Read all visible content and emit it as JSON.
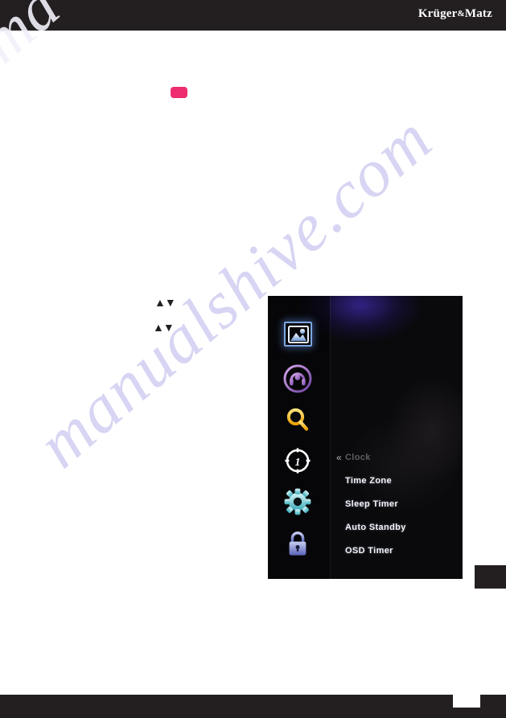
{
  "header": {
    "brand_name": "Krüger",
    "brand_amp": "&",
    "brand_name2": "Matz"
  },
  "watermark": {
    "text": "manualshive.com",
    "corner_text": "ma",
    "color": "#c9c6ef"
  },
  "badge": {
    "color": "#ed2d70",
    "label": ""
  },
  "arrow_hints": [
    {
      "glyph": "▲▼",
      "name": "up-down-arrows"
    },
    {
      "glyph": "▲▼",
      "name": "up-down-arrows"
    }
  ],
  "osd": {
    "icons": [
      {
        "name": "picture-icon",
        "label": "Picture",
        "selected": true,
        "color": "#cfe2f7"
      },
      {
        "name": "headphones-icon",
        "label": "Sound",
        "selected": false,
        "color": "#b07fd4"
      },
      {
        "name": "search-icon",
        "label": "Channel",
        "selected": false,
        "color": "#f5c024"
      },
      {
        "name": "clock-icon",
        "label": "Time",
        "selected": false,
        "color": "#ffffff"
      },
      {
        "name": "gear-icon",
        "label": "Setup",
        "selected": false,
        "color": "#7fd8d8"
      },
      {
        "name": "lock-icon",
        "label": "Lock",
        "selected": false,
        "color": "#7d85d0"
      }
    ],
    "menu_items": [
      {
        "label": "Clock",
        "dimmed": true,
        "chevron": "«"
      },
      {
        "label": "Time Zone",
        "dimmed": false,
        "chevron": ""
      },
      {
        "label": "Sleep Timer",
        "dimmed": false,
        "chevron": ""
      },
      {
        "label": "Auto Standby",
        "dimmed": false,
        "chevron": ""
      },
      {
        "label": "OSD Timer",
        "dimmed": false,
        "chevron": ""
      }
    ]
  }
}
